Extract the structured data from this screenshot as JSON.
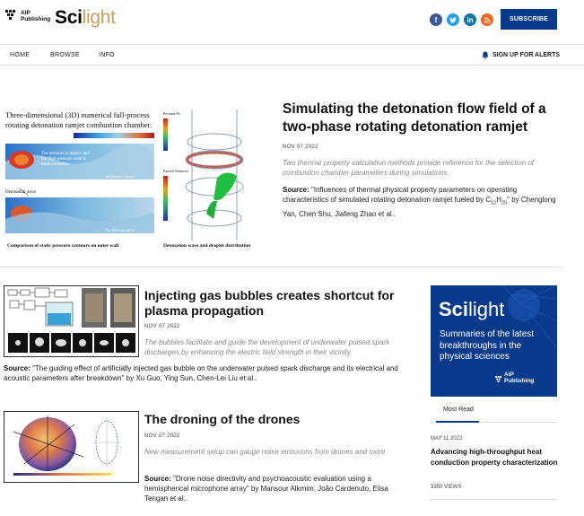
{
  "header": {
    "publisher_line1": "AIP",
    "publisher_line2": "Publishing",
    "site_name_a": "Sci",
    "site_name_b": "light",
    "social_icons": [
      "facebook-icon",
      "twitter-icon",
      "linkedin-icon",
      "rss-icon"
    ],
    "subscribe_label": "SUBSCRIBE"
  },
  "nav": {
    "items": [
      "HOME",
      "BROWSE",
      "INFO"
    ],
    "alerts_label": "SIGN UP FOR ALERTS"
  },
  "feature": {
    "title": "Simulating the detonation flow field of a two-phase rotating detonation ramjet",
    "date": "NOV 07 2022",
    "summary": "Two thermal property calculation methods provide reference for the selection of combustion chamber parameters during simulations.",
    "source_label": "Source:",
    "source_text": "\"Influences of thermal physical property parameters on operating characteristics of simulated rotating detonation ramjet fueled by C",
    "source_sub1": "12",
    "source_mid": "H",
    "source_sub2": "25",
    "source_tail": "\" by Chenglong Yan, Chen Shu, Jiafeng Zhao et al..",
    "figure": {
      "title_line1": "Three-dimensional (3D) numerical full-process",
      "title_line2": "rotating detonation ramjet combustion chamber.",
      "legend_pressure": "Pressure Pa",
      "note1": "The pressure is higher, and",
      "note2": "the high-pressure zone is",
      "note3": "more extensive.",
      "label_wave": "Detonation wave",
      "label_theory": "(a) Kinetic theory",
      "label_polynomial": "(b) Polynomial fit",
      "caption_left": "Comparison of static pressure contours on outer wall",
      "caption_right": "Detonation wave and droplet distribution",
      "legend_particle": "Particle Diameter"
    }
  },
  "articles": [
    {
      "title": "Injecting gas bubbles creates shortcut for plasma propagation",
      "date": "NOV 07 2022",
      "summary": "The bubbles facilitate and guide the development of underwater pulsed spark discharges by enhancing the electric field strength in their vicinity.",
      "source_label": "Source:",
      "source_text": "\"The guiding effect of artificially injected gas bubble on the underwater pulsed spark discharge and its electrical and acoustic parameters after breakdown\" by Xu Guo, Ying Sun, Chen-Lei Liu et al.."
    },
    {
      "title": "The droning of the drones",
      "date": "NOV 07 2022",
      "summary": "New measurement setup can gauge noise emissions from drones and more",
      "source_label": "Source:",
      "source_text": "\"Drone noise directivity and psychoacoustic evaluation using a hemispherical microphone array\" by Mansour Alkmim, João Cardenuto, Elisa Tengan et al.."
    }
  ],
  "sidebar": {
    "ad_title_a": "Sci",
    "ad_title_b": "light",
    "ad_text": "Summaries of the latest breakthroughs in the physical sciences",
    "ad_logo_line1": "AIP",
    "ad_logo_line2": "Publishing",
    "tab_label": "Most Read",
    "most_read": {
      "date": "MAY 11 2022",
      "title": "Advancing high-throughput heat conduction property characterization",
      "views": "3350 VIEWS"
    }
  },
  "colors": {
    "brand_blue": "#0a3a8c",
    "gold": "#c5a05a"
  }
}
